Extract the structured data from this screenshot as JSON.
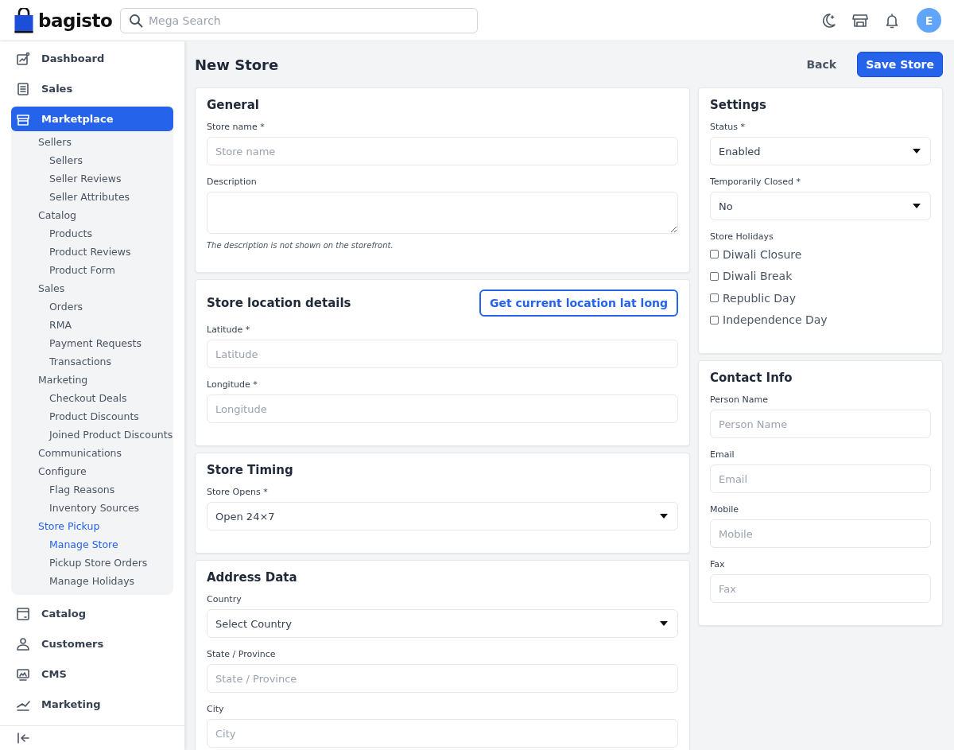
{
  "header": {
    "logo": "bagisto",
    "search": {
      "placeholder": "Mega Search"
    },
    "avatar": "E"
  },
  "sidebar": {
    "items": [
      {
        "label": "Dashboard",
        "selected": false
      },
      {
        "label": "Sales",
        "selected": false
      },
      {
        "label": "Marketplace",
        "selected": true,
        "children": [
          {
            "label": "Sellers",
            "selected": false,
            "children": [
              {
                "label": "Sellers",
                "selected": false
              },
              {
                "label": "Seller Reviews",
                "selected": false
              },
              {
                "label": "Seller Attributes",
                "selected": false
              }
            ]
          },
          {
            "label": "Catalog",
            "selected": false,
            "children": [
              {
                "label": "Products",
                "selected": false
              },
              {
                "label": "Product Reviews",
                "selected": false
              },
              {
                "label": "Product Form",
                "selected": false
              }
            ]
          },
          {
            "label": "Sales",
            "selected": false,
            "children": [
              {
                "label": "Orders",
                "selected": false
              },
              {
                "label": "RMA",
                "selected": false
              },
              {
                "label": "Payment Requests",
                "selected": false
              },
              {
                "label": "Transactions",
                "selected": false
              }
            ]
          },
          {
            "label": "Marketing",
            "selected": false,
            "children": [
              {
                "label": "Checkout Deals",
                "selected": false
              },
              {
                "label": "Product Discounts",
                "selected": false
              },
              {
                "label": "Joined Product Discounts",
                "selected": false
              }
            ]
          },
          {
            "label": "Communications",
            "selected": false
          },
          {
            "label": "Configure",
            "selected": false,
            "children": [
              {
                "label": "Flag Reasons",
                "selected": false
              },
              {
                "label": "Inventory Sources",
                "selected": false
              }
            ]
          },
          {
            "label": "Store Pickup",
            "selected": true,
            "children": [
              {
                "label": "Manage Store",
                "selected": true
              },
              {
                "label": "Pickup Store Orders",
                "selected": false
              },
              {
                "label": "Manage Holidays",
                "selected": false
              }
            ]
          }
        ]
      },
      {
        "label": "Catalog",
        "selected": false
      },
      {
        "label": "Customers",
        "selected": false
      },
      {
        "label": "CMS",
        "selected": false
      },
      {
        "label": "Marketing",
        "selected": false
      }
    ]
  },
  "page": {
    "title": "New Store",
    "back": "Back",
    "save": "Save Store"
  },
  "left_cards": [
    {
      "title": "General",
      "fields": [
        {
          "kind": "text",
          "label": "Store name *",
          "placeholder": "Store name"
        },
        {
          "kind": "textarea",
          "label": "Description",
          "note": "The description is not shown on the storefront."
        }
      ]
    },
    {
      "title": "Store location details",
      "action": "Get current location lat long",
      "fields": [
        {
          "kind": "text",
          "label": "Latitude *",
          "placeholder": "Latitude"
        },
        {
          "kind": "text",
          "label": "Longitude *",
          "placeholder": "Longitude"
        }
      ]
    },
    {
      "title": "Store Timing",
      "fields": [
        {
          "kind": "select",
          "label": "Store Opens *",
          "value": "Open 24×7"
        }
      ]
    },
    {
      "title": "Address Data",
      "fields": [
        {
          "kind": "select",
          "label": "Country",
          "value": "Select Country"
        },
        {
          "kind": "text",
          "label": "State / Province",
          "placeholder": "State / Province"
        },
        {
          "kind": "text",
          "label": "City",
          "placeholder": "City"
        }
      ]
    }
  ],
  "right_cards": [
    {
      "title": "Settings",
      "fields": [
        {
          "kind": "select",
          "label": "Status *",
          "value": "Enabled"
        },
        {
          "kind": "select",
          "label": "Temporarily Closed *",
          "value": "No"
        },
        {
          "kind": "checkboxes",
          "label": "Store Holidays",
          "options": [
            {
              "label": "Diwali Closure",
              "checked": false
            },
            {
              "label": "Diwali Break",
              "checked": false
            },
            {
              "label": "Republic Day",
              "checked": false
            },
            {
              "label": "Independence Day",
              "checked": false
            }
          ]
        }
      ]
    },
    {
      "title": "Contact Info",
      "fields": [
        {
          "kind": "text",
          "label": "Person Name",
          "placeholder": "Person Name"
        },
        {
          "kind": "text",
          "label": "Email",
          "placeholder": "Email"
        },
        {
          "kind": "text",
          "label": "Mobile",
          "placeholder": "Mobile"
        },
        {
          "kind": "text",
          "label": "Fax",
          "placeholder": "Fax"
        }
      ]
    }
  ]
}
